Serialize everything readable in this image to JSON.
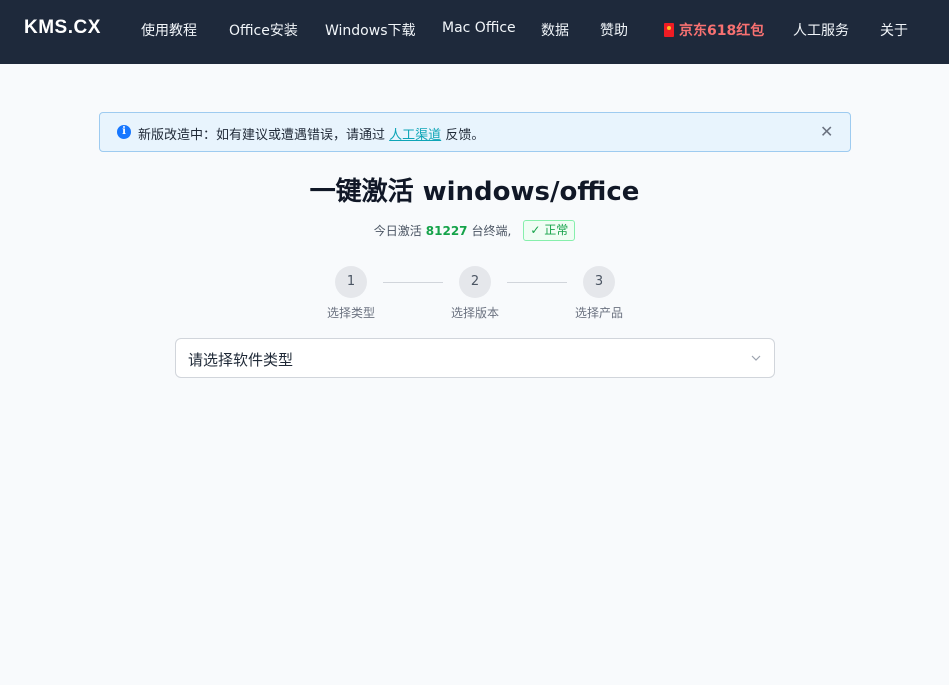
{
  "navbar": {
    "logo": "KMS.CX",
    "items": [
      {
        "label": "使用教程"
      },
      {
        "label": "Office安装"
      },
      {
        "label": "Windows下载"
      },
      {
        "label": "Mac Office"
      },
      {
        "label": "数据"
      },
      {
        "label": "赞助"
      },
      {
        "label": "京东618红包",
        "icon": "red-envelope-icon",
        "color": "#f87171"
      },
      {
        "label": "人工服务"
      },
      {
        "label": "关于"
      }
    ]
  },
  "alert": {
    "icon": "info-icon",
    "prefix": "新版改造中：如有建议或遭遇错误，请通过",
    "link": "人工渠道",
    "suffix": "反馈。",
    "close_icon": "close-icon"
  },
  "hero": {
    "title": "一键激活 windows/office",
    "status_prefix": "今日激活",
    "count": "81227",
    "status_suffix": "台终端,",
    "badge": "✓ 正常"
  },
  "steps": [
    {
      "number": "1",
      "label": "选择类型"
    },
    {
      "number": "2",
      "label": "选择版本"
    },
    {
      "number": "3",
      "label": "选择产品"
    }
  ],
  "select": {
    "placeholder": "请选择软件类型"
  },
  "colors": {
    "navbar_bg": "#1e293b",
    "accent_green": "#16a34a",
    "link": "#0ea5b7",
    "promo": "#f87171"
  }
}
